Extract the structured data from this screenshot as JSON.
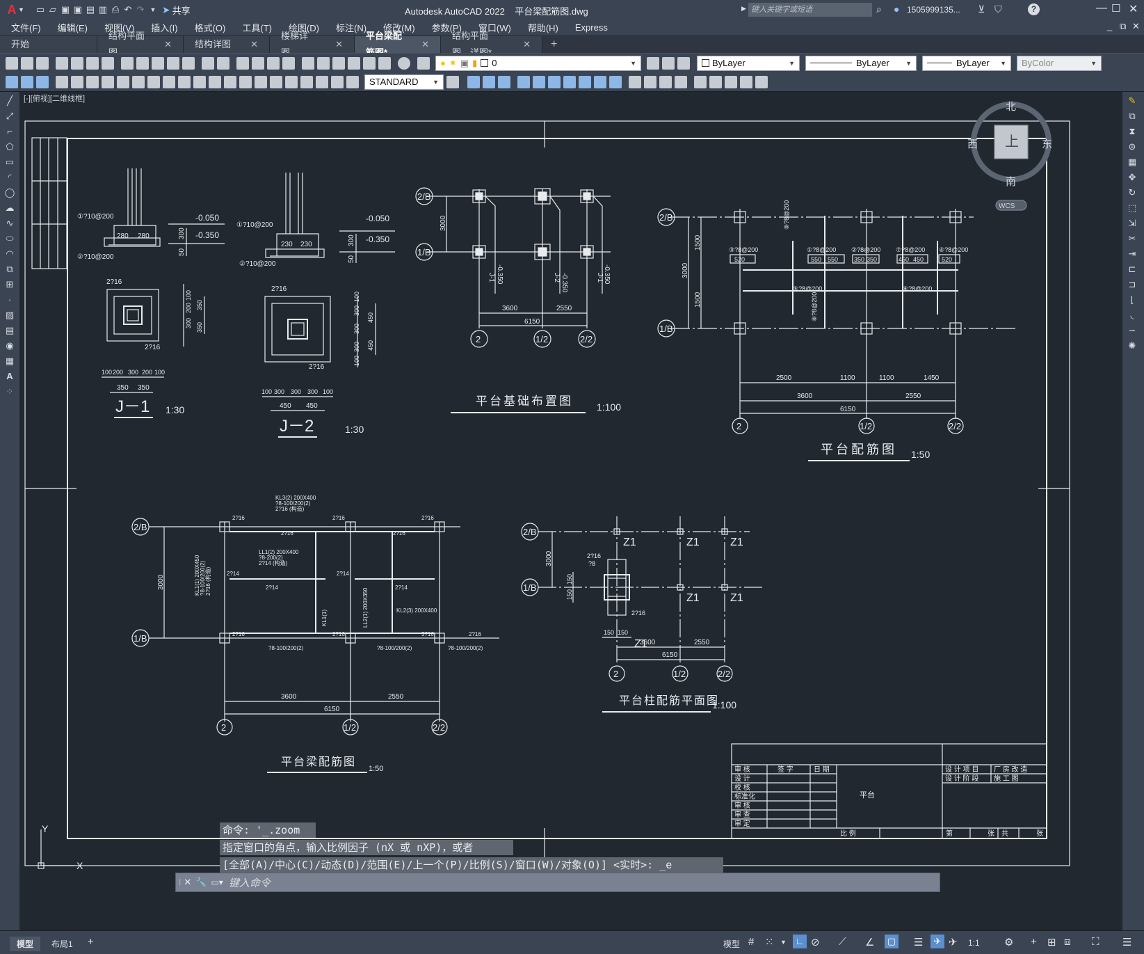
{
  "title": {
    "app_letter": "A",
    "share": "共享",
    "window_title": "Autodesk AutoCAD 2022",
    "filename": "平台梁配筋图.dwg",
    "search_placeholder": "键入关键字或短语",
    "user": "1505999135..."
  },
  "menus": [
    "文件(F)",
    "编辑(E)",
    "视图(V)",
    "插入(I)",
    "格式(O)",
    "工具(T)",
    "绘图(D)",
    "标注(N)",
    "修改(M)",
    "参数(P)",
    "窗口(W)",
    "帮助(H)",
    "Express"
  ],
  "tabs": [
    {
      "label": "开始",
      "close": false
    },
    {
      "label": "结构平面图",
      "close": true
    },
    {
      "label": "结构详图",
      "close": true
    },
    {
      "label": "楼梯详图",
      "close": true
    },
    {
      "label": "平台梁配筋图*",
      "close": true,
      "active": true
    },
    {
      "label": "结构平面图、详图*",
      "close": true
    }
  ],
  "toolbar": {
    "layer": "0",
    "color": "ByLayer",
    "linetype": "ByLayer",
    "lineweight": "ByLayer",
    "plotstyle": "ByColor",
    "textstyle": "STANDARD"
  },
  "viewport": {
    "label": "[-][俯视][二维线框]"
  },
  "viewcube": {
    "north": "北",
    "south": "南",
    "east": "东",
    "west": "西",
    "top": "上",
    "wcs": "WCS"
  },
  "ucs": {
    "x": "X",
    "y": "Y"
  },
  "drawing": {
    "j1": {
      "title": "J－1",
      "scale": "1:30",
      "rebar1": "①?10@200",
      "rebar2": "②?10@200",
      "elev1": "-0.050",
      "elev2": "-0.350",
      "d1": "280",
      "d2": "280",
      "d3": "300",
      "d4": "50",
      "top": "2?16",
      "side": "2?16",
      "dv1": "100",
      "dv2": "200",
      "dv3": "300",
      "dv4": "350",
      "dv5": "350",
      "db": [
        "100",
        "200",
        "300",
        "200",
        "100"
      ],
      "dbb": [
        "350",
        "350"
      ]
    },
    "j2": {
      "title": "J－2",
      "scale": "1:30",
      "rebar1": "①?10@200",
      "rebar2": "②?10@200",
      "elev1": "-0.050",
      "elev2": "-0.350",
      "d1": "230",
      "d2": "230",
      "d3": "300",
      "d4": "50",
      "top": "2?16",
      "side": "2?16",
      "dv": [
        "100",
        "300",
        "300",
        "300",
        "100"
      ],
      "dv2": [
        "450",
        "450"
      ],
      "db": [
        "100",
        "300",
        "300",
        "300",
        "100"
      ],
      "dbb": [
        "450",
        "450"
      ]
    },
    "foundation": {
      "title": "平台基础布置图",
      "scale": "1:100",
      "axes_h": [
        "2/B",
        "1/B"
      ],
      "axes_v": [
        "2",
        "1/2",
        "2/2"
      ],
      "dims": [
        "3000",
        "3600",
        "2550",
        "6150"
      ],
      "labels": [
        "J-1",
        "J-2",
        "J-1"
      ],
      "elev": [
        "-0.350",
        "-0.350",
        "-0.350"
      ]
    },
    "slab": {
      "title": "平台配筋图",
      "scale": "1:50",
      "axes_h": [
        "2/B",
        "1/B"
      ],
      "axes_v": [
        "2",
        "1/2",
        "2/2"
      ],
      "dims_v": [
        "1500",
        "3000",
        "1500"
      ],
      "dims_b1": [
        "2500",
        "1100",
        "1100",
        "1450"
      ],
      "dims_b2": [
        "3600",
        "2550"
      ],
      "dims_b3": "6150",
      "rebars": [
        "③?8@200",
        "①?8@200",
        "②?8@200",
        "⑦?8@200",
        "④?8@200",
        "⑤?8@200",
        "⑥?8@200",
        "⑨?8@200",
        "⑧?8@200"
      ],
      "sub": [
        "520",
        "550",
        "550",
        "350",
        "350",
        "450",
        "450",
        "520"
      ]
    },
    "beam": {
      "title": "平台梁配筋图",
      "scale": "1:50",
      "axes_h": [
        "2/B",
        "1/B"
      ],
      "axes_v": [
        "2",
        "1/2",
        "2/2"
      ],
      "dims_v": "3000",
      "dims_b": [
        "3600",
        "2550",
        "6150"
      ],
      "notes": [
        "KL3(2) 200X400",
        "?8-100/200(2)",
        "2?16 (构造)",
        "LL1(2) 200X400",
        "?8-200(2)",
        "2?14 (构造)",
        "KL1(1) 200X450",
        "?8-100/200(2)",
        "2?16 (构造)",
        "2?16",
        "2?14",
        "3?16",
        "?8-100/200(2)",
        "KL1(1)",
        "KL2(3) 200X400",
        "LL2(1) 200X350"
      ]
    },
    "column": {
      "title": "平台柱配筋平面图",
      "scale": "1:100",
      "axes_h": [
        "2/B",
        "1/B"
      ],
      "axes_v": [
        "2",
        "1/2",
        "2/2"
      ],
      "z": [
        "Z1",
        "Z1",
        "Z1",
        "Z1",
        "Z1",
        "Z1"
      ],
      "dims": [
        "3000",
        "150",
        "150",
        "3600",
        "2550",
        "6150"
      ],
      "detail": [
        "2?16",
        "?8",
        "2?16"
      ]
    },
    "titleblock": {
      "rows": [
        "审  核",
        "设  计",
        "校  核",
        "标准化",
        "审  核",
        "审  查",
        "审  定"
      ],
      "h2": "签  字",
      "h3": "日  期",
      "project": "平台",
      "r1a": "设 计 项 目",
      "r1b": "厂 房 改 造",
      "r2a": "设 计 阶 段",
      "r2b": "施  工  图",
      "bottom": [
        "比  例",
        "第",
        "张",
        "共",
        "张"
      ]
    }
  },
  "command": {
    "l1": "命令: '_.zoom",
    "l2": "指定窗口的角点，输入比例因子 (nX 或 nXP)，或者",
    "l3": "[全部(A)/中心(C)/动态(D)/范围(E)/上一个(P)/比例(S)/窗口(W)/对象(O)] <实时>: _e",
    "placeholder": "键入命令"
  },
  "layout_tabs": [
    "模型",
    "布局1"
  ],
  "status": {
    "model": "模型",
    "scale": "1:1"
  }
}
